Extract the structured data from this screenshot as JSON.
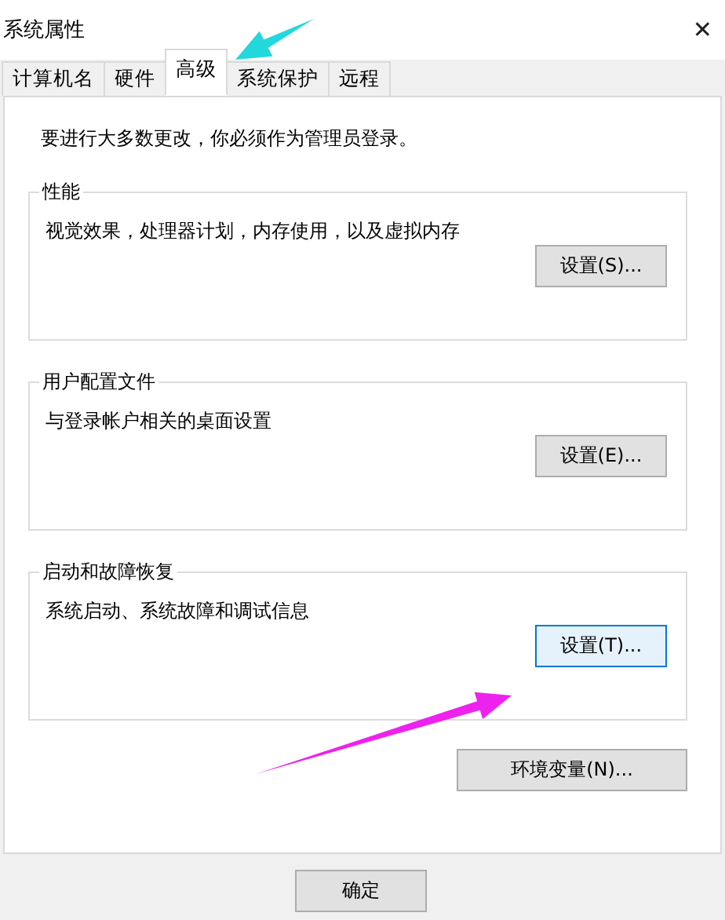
{
  "window": {
    "title": "系统属性",
    "close": "✕"
  },
  "tabs": [
    {
      "label": "计算机名",
      "selected": false
    },
    {
      "label": "硬件",
      "selected": false
    },
    {
      "label": "高级",
      "selected": true
    },
    {
      "label": "系统保护",
      "selected": false
    },
    {
      "label": "远程",
      "selected": false
    }
  ],
  "notice": "要进行大多数更改，你必须作为管理员登录。",
  "groups": [
    {
      "title": "性能",
      "description": "视觉效果，处理器计划，内存使用，以及虚拟内存",
      "button": {
        "label": "设置(S)...",
        "focused": false
      }
    },
    {
      "title": "用户配置文件",
      "description": "与登录帐户相关的桌面设置",
      "button": {
        "label": "设置(E)...",
        "focused": false
      }
    },
    {
      "title": "启动和故障恢复",
      "description": "系统启动、系统故障和调试信息",
      "button": {
        "label": "设置(T)...",
        "focused": true
      }
    }
  ],
  "env_button": {
    "label": "环境变量(N)...",
    "focused": false
  },
  "footer_buttons": [
    {
      "label": "确定",
      "focused": false
    }
  ],
  "annotations": [
    {
      "kind": "arrow",
      "color": "#22d8dc"
    },
    {
      "kind": "arrow",
      "color": "#ee22ee"
    }
  ]
}
